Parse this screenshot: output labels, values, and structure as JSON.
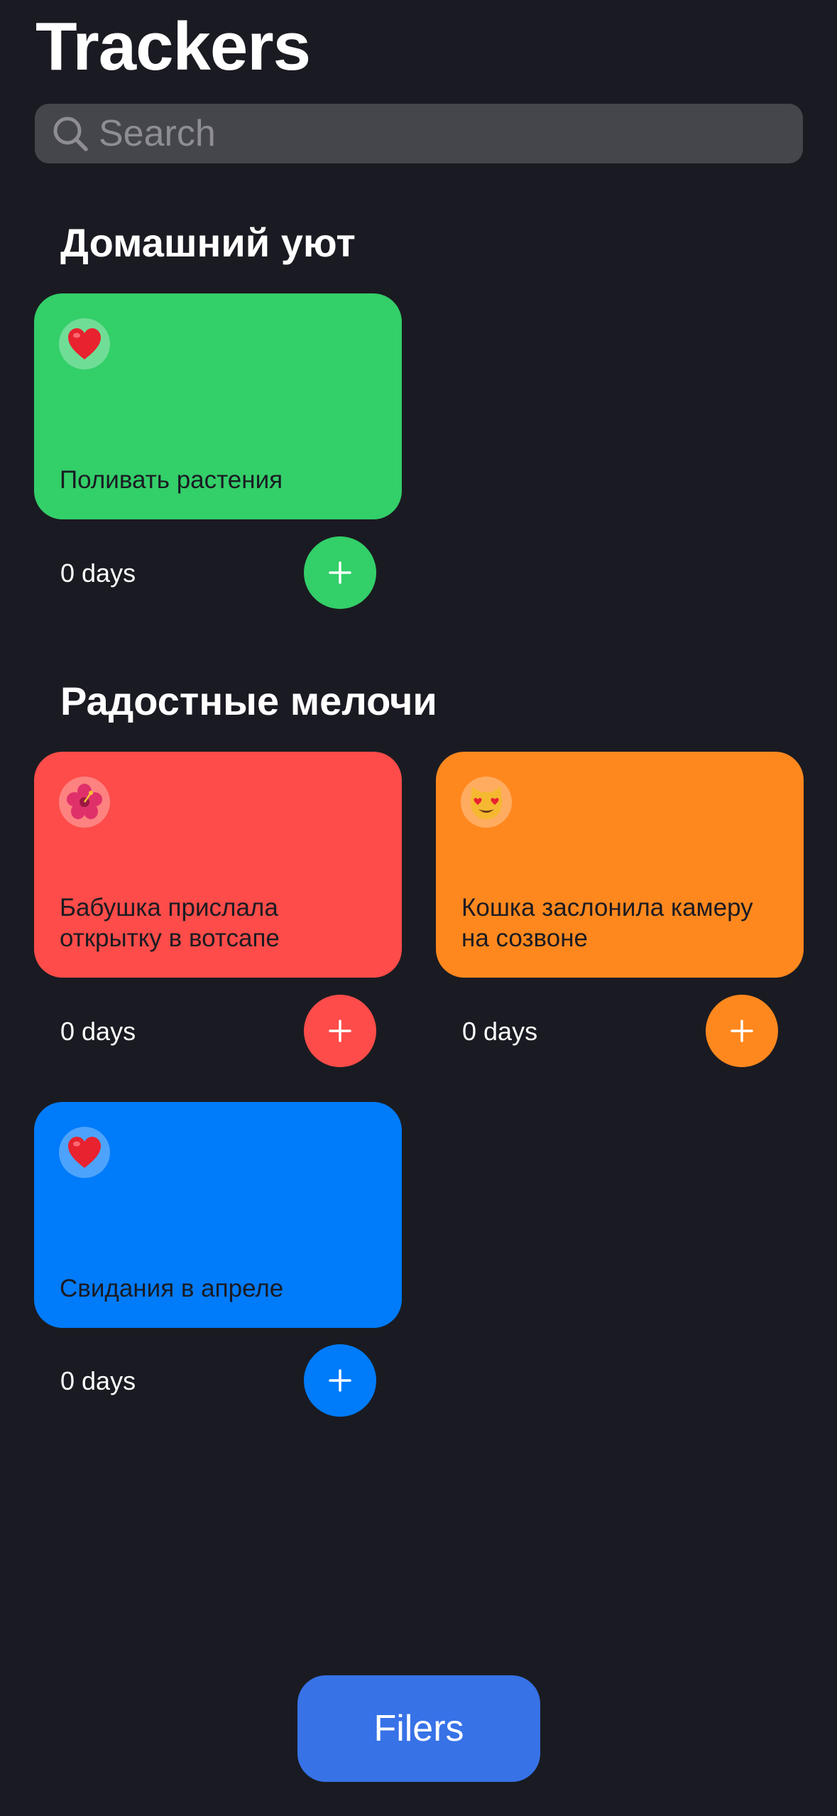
{
  "header": {
    "title": "Trackers"
  },
  "search": {
    "placeholder": "Search"
  },
  "sections": [
    {
      "title": "Домашний уют",
      "trackers": [
        {
          "emoji": "❤️",
          "title": "Поливать растения",
          "days": "0 days",
          "color": "#33cf69"
        }
      ]
    },
    {
      "title": "Радостные мелочи",
      "trackers": [
        {
          "emoji": "🌺",
          "title": "Бабушка прислала открытку в вотсапе",
          "days": "0 days",
          "color": "#fd4c49"
        },
        {
          "emoji": "😻",
          "title": "Кошка заслонила камеру на созвоне",
          "days": "0 days",
          "color": "#ff881e"
        },
        {
          "emoji": "❤️",
          "title": "Свидания в апреле",
          "days": "0 days",
          "color": "#007bfa"
        }
      ]
    }
  ],
  "filters": {
    "label": "Filers",
    "color": "#3772e7"
  }
}
